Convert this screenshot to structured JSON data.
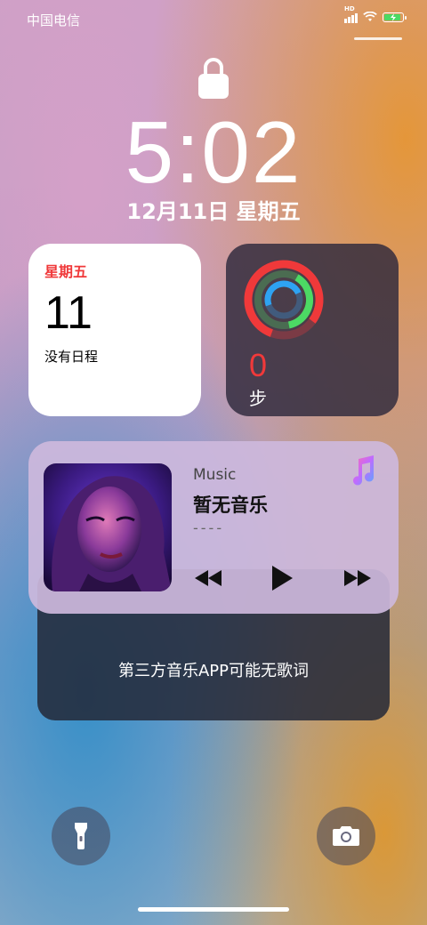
{
  "status_bar": {
    "carrier": "中国电信",
    "network_label": "HD"
  },
  "lock_screen": {
    "time": "5:02",
    "date": "12月11日 星期五"
  },
  "calendar_widget": {
    "weekday": "星期五",
    "day": "11",
    "events_text": "没有日程"
  },
  "activity_widget": {
    "steps": "0",
    "unit": "步"
  },
  "music_widget": {
    "app_name": "Music",
    "title": "暂无音乐",
    "artist": "----",
    "icons": [
      "music-note-icon",
      "previous-icon",
      "play-icon",
      "next-icon"
    ]
  },
  "lyrics_card": {
    "text": "第三方音乐APP可能无歌词"
  },
  "quick_actions": {
    "icons": [
      "flashlight-icon",
      "camera-icon"
    ]
  },
  "colors": {
    "accent_red": "#f0393a",
    "accent_green": "#4cd964",
    "ring_blue": "#2ea3f2"
  }
}
